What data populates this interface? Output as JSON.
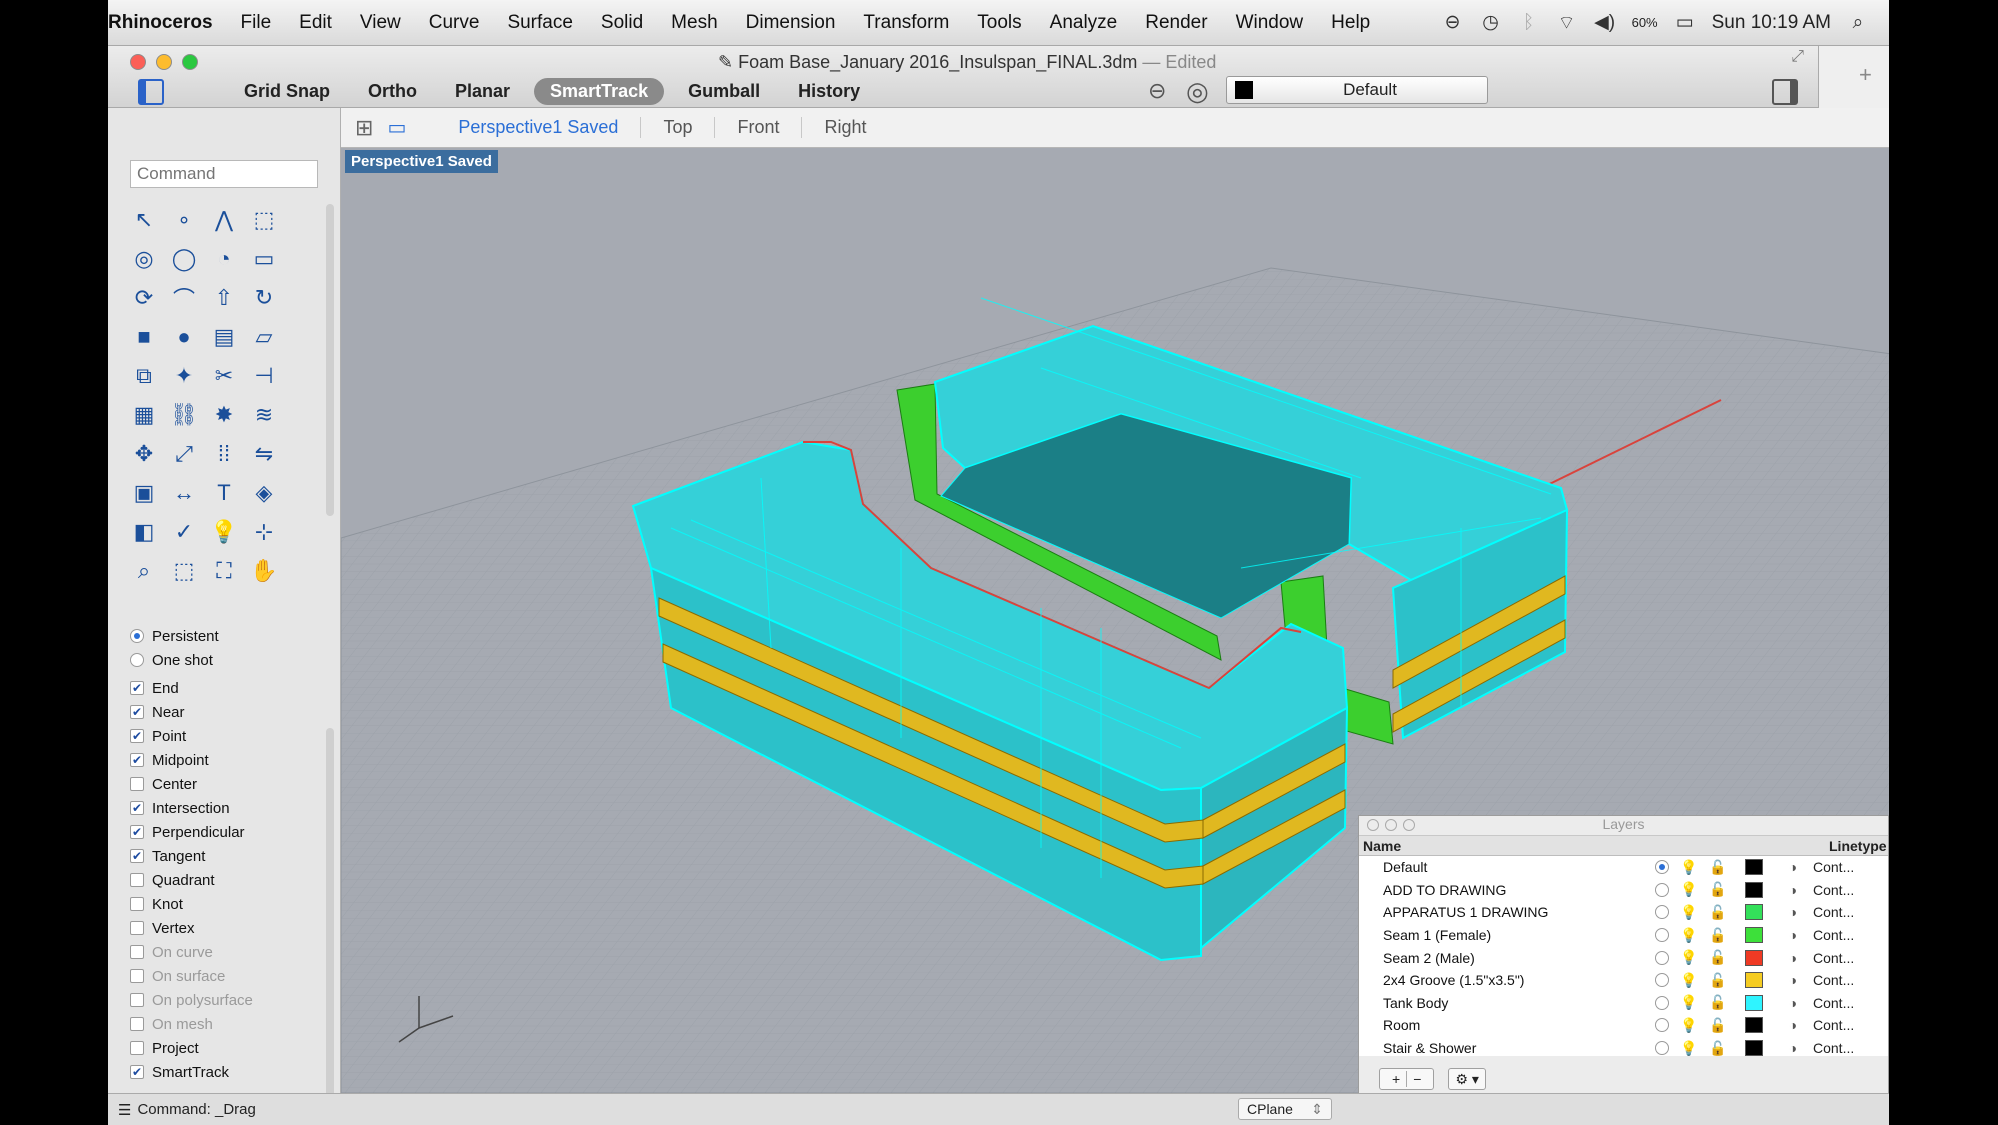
{
  "menubar": {
    "app": "Rhinoceros",
    "items": [
      "File",
      "Edit",
      "View",
      "Curve",
      "Surface",
      "Solid",
      "Mesh",
      "Dimension",
      "Transform",
      "Tools",
      "Analyze",
      "Render",
      "Window",
      "Help"
    ],
    "battery": "60%",
    "clock": "Sun 10:19 AM"
  },
  "window": {
    "title": "Foam Base_January 2016_Insulspan_FINAL.3dm",
    "edited": "— Edited",
    "toolbar": [
      "Grid Snap",
      "Ortho",
      "Planar",
      "SmartTrack",
      "Gumball",
      "History"
    ],
    "active_toggle": "SmartTrack",
    "layer_selector": "Default"
  },
  "viewport_tabs": {
    "active": "Perspective1 Saved",
    "others": [
      "Top",
      "Front",
      "Right"
    ]
  },
  "viewport": {
    "label": "Perspective1 Saved",
    "colors": {
      "bg": "#a6aab2",
      "tank": "#35d0d8",
      "tank_edge": "#00ffff",
      "groove": "#e0b820",
      "seam": "#3ccf2e",
      "seam_red": "#e84a2a"
    }
  },
  "command": {
    "placeholder": "Command"
  },
  "tools": {
    "icons": [
      "select-arrow-icon",
      "point-icon",
      "polyline-icon",
      "curve-rect-icon",
      "circle-icon",
      "ellipse-icon",
      "arc-icon",
      "rectangle-icon",
      "offset-icon",
      "fillet-icon",
      "extrude-curve-icon",
      "revolve-icon",
      "box-icon",
      "sphere-icon",
      "cylinder-icon",
      "plane-icon",
      "boolean-icon",
      "solid-edit-icon",
      "split-icon",
      "trim-icon",
      "mesh-icon",
      "join-icon",
      "explode-icon",
      "rebuild-icon",
      "move-icon",
      "scale-icon",
      "array-icon",
      "mirror-icon",
      "render-icon",
      "dimension-icon",
      "text-icon",
      "analyze-icon",
      "layer-tool-icon",
      "check-icon",
      "lightbulb-icon",
      "edit-points-icon",
      "zoom-icon",
      "zoom-window-icon",
      "zoom-extents-icon",
      "pan-icon"
    ],
    "glyphs": [
      "↖",
      "∘",
      "⋀",
      "⬚",
      "◎",
      "◯",
      "◔",
      "▭",
      "⟳",
      "⌒",
      "⇧",
      "↻",
      "■",
      "●",
      "▤",
      "▱",
      "⧉",
      "✦",
      "✂",
      "⊣",
      "▦",
      "⛓",
      "✸",
      "≋",
      "✥",
      "⤢",
      "⁞⁞",
      "⇋",
      "▣",
      "↔",
      "T",
      "◈",
      "◧",
      "✓",
      "💡",
      "⊹",
      "⌕",
      "⬚",
      "⛶",
      "✋"
    ]
  },
  "osnap": {
    "mode": [
      {
        "label": "Persistent",
        "on": true
      },
      {
        "label": "One shot",
        "on": false
      }
    ],
    "items": [
      {
        "label": "End",
        "checked": true,
        "enabled": true
      },
      {
        "label": "Near",
        "checked": true,
        "enabled": true
      },
      {
        "label": "Point",
        "checked": true,
        "enabled": true
      },
      {
        "label": "Midpoint",
        "checked": true,
        "enabled": true
      },
      {
        "label": "Center",
        "checked": false,
        "enabled": true
      },
      {
        "label": "Intersection",
        "checked": true,
        "enabled": true
      },
      {
        "label": "Perpendicular",
        "checked": true,
        "enabled": true
      },
      {
        "label": "Tangent",
        "checked": true,
        "enabled": true
      },
      {
        "label": "Quadrant",
        "checked": false,
        "enabled": true
      },
      {
        "label": "Knot",
        "checked": false,
        "enabled": true
      },
      {
        "label": "Vertex",
        "checked": false,
        "enabled": true
      },
      {
        "label": "On curve",
        "checked": false,
        "enabled": false
      },
      {
        "label": "On surface",
        "checked": false,
        "enabled": false
      },
      {
        "label": "On polysurface",
        "checked": false,
        "enabled": false
      },
      {
        "label": "On mesh",
        "checked": false,
        "enabled": false
      },
      {
        "label": "Project",
        "checked": false,
        "enabled": true
      },
      {
        "label": "SmartTrack",
        "checked": true,
        "enabled": true
      }
    ]
  },
  "layers": {
    "title": "Layers",
    "col_name": "Name",
    "col_linetype": "Linetype",
    "rows": [
      {
        "name": "Default",
        "current": true,
        "color": "#000000",
        "linetype": "Cont..."
      },
      {
        "name": "ADD TO DRAWING",
        "current": false,
        "color": "#000000",
        "linetype": "Cont..."
      },
      {
        "name": "APPARATUS 1 DRAWING",
        "current": false,
        "color": "#33e05a",
        "linetype": "Cont..."
      },
      {
        "name": "Seam 1 (Female)",
        "current": false,
        "color": "#3de03a",
        "linetype": "Cont..."
      },
      {
        "name": "Seam 2 (Male)",
        "current": false,
        "color": "#ef3a24",
        "linetype": "Cont..."
      },
      {
        "name": "2x4 Groove (1.5\"x3.5\")",
        "current": false,
        "color": "#f5cc22",
        "linetype": "Cont..."
      },
      {
        "name": "Tank Body",
        "current": false,
        "color": "#2ff4ff",
        "linetype": "Cont..."
      },
      {
        "name": "Room",
        "current": false,
        "color": "#000000",
        "linetype": "Cont..."
      },
      {
        "name": "Stair & Shower",
        "current": false,
        "color": "#000000",
        "linetype": "Cont..."
      }
    ],
    "footer": {
      "add": "+",
      "remove": "−",
      "gear": "⚙ ▾"
    }
  },
  "status": {
    "command": "Command: _Drag",
    "cplane": "CPlane"
  }
}
